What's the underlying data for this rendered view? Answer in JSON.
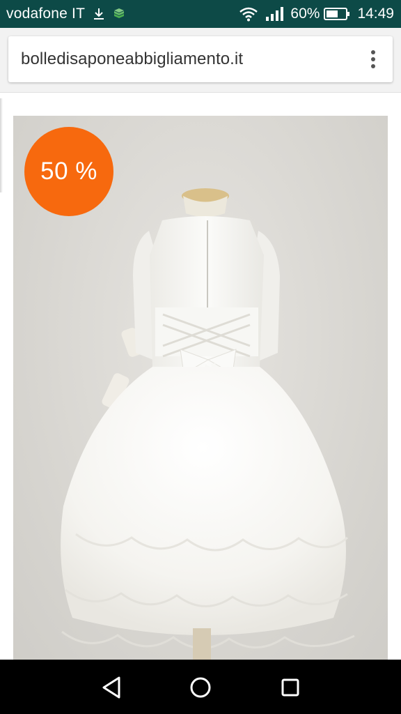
{
  "status_bar": {
    "carrier": "vodafone IT",
    "battery_percent": "60%",
    "time": "14:49",
    "background": "#0d4a47",
    "icons": [
      "download-icon",
      "app-notification-icon",
      "wifi-icon",
      "signal-icon",
      "battery-icon"
    ],
    "battery_level": 0.6
  },
  "browser": {
    "url": "bolledisaponeabbigliamento.it",
    "menu_icon": "overflow-menu-icon"
  },
  "product": {
    "image": "white-dress-back-photo",
    "discount_label": "50 %",
    "badge_color": "#f7690e"
  },
  "navigation": {
    "buttons": [
      "back-icon",
      "home-icon",
      "recent-apps-icon"
    ]
  }
}
